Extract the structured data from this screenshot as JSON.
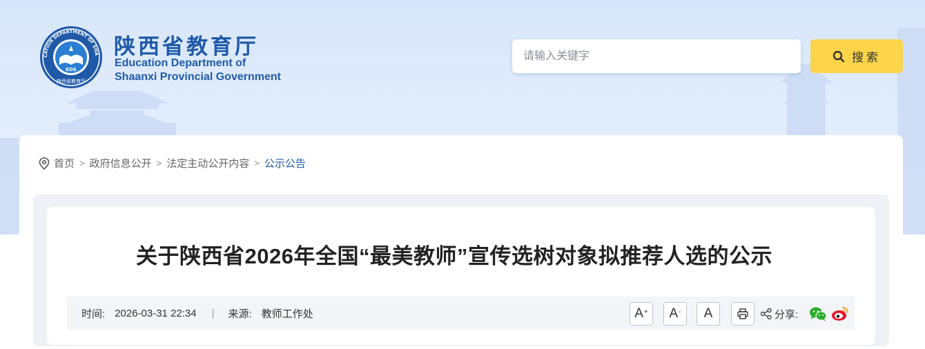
{
  "header": {
    "logo_cn": "陕西省教育厅",
    "logo_en_line1": "Education Department of",
    "logo_en_line2": "Shaanxi Provincial Government",
    "emblem_ring_text": "EDUCATION DEPARTMENT OF SHAANXI",
    "emblem_bottom_text": "陕西省教育厅",
    "emblem_center_text": "EDS"
  },
  "search": {
    "placeholder": "请输入关键字",
    "button_label": "搜索"
  },
  "breadcrumb": {
    "items": [
      "首页",
      "政府信息公开",
      "法定主动公开内容",
      "公示公告"
    ],
    "separator": ">"
  },
  "article": {
    "title": "关于陕西省2026年全国“最美教师”宣传选树对象拟推荐人选的公示",
    "time_label": "时间:",
    "time_value": "2026-03-31 22:34",
    "divider": "|",
    "source_label": "来源:",
    "source_value": "教师工作处"
  },
  "toolbar": {
    "font_increase": "A",
    "font_increase_mark": "+",
    "font_decrease": "A",
    "font_decrease_mark": "-",
    "font_reset": "A",
    "share_label": "分享:"
  },
  "colors": {
    "brand_blue": "#1f5aa8",
    "search_button": "#fbd44a",
    "header_bg": "#d7e6fa",
    "wechat": "#2aae2a",
    "weibo": "#e6162d"
  },
  "icons": [
    "search-icon",
    "location-pin-icon",
    "print-icon",
    "share-icon",
    "wechat-icon",
    "weibo-icon"
  ]
}
